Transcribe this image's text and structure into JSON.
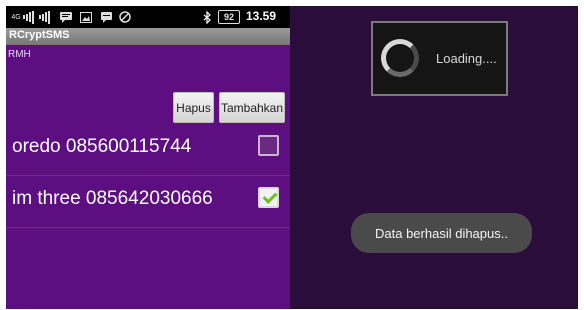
{
  "statusbar": {
    "network_label": "4G",
    "battery_level": "92",
    "time": "13.59"
  },
  "app": {
    "title": "RCryptSMS",
    "subtitle": "RMH"
  },
  "buttons": {
    "delete_label": "Hapus",
    "add_label": "Tambahkan"
  },
  "contacts": [
    {
      "label": "oredo 085600115744",
      "checked": false
    },
    {
      "label": "im three 085642030666",
      "checked": true
    }
  ],
  "dialog": {
    "loading_text": "Loading...."
  },
  "toast": {
    "message": "Data berhasil dihapus.."
  },
  "colors": {
    "app_background": "#5d0e80",
    "dim_background": "#2a0d3a",
    "check_accent": "#6bbf1e"
  }
}
